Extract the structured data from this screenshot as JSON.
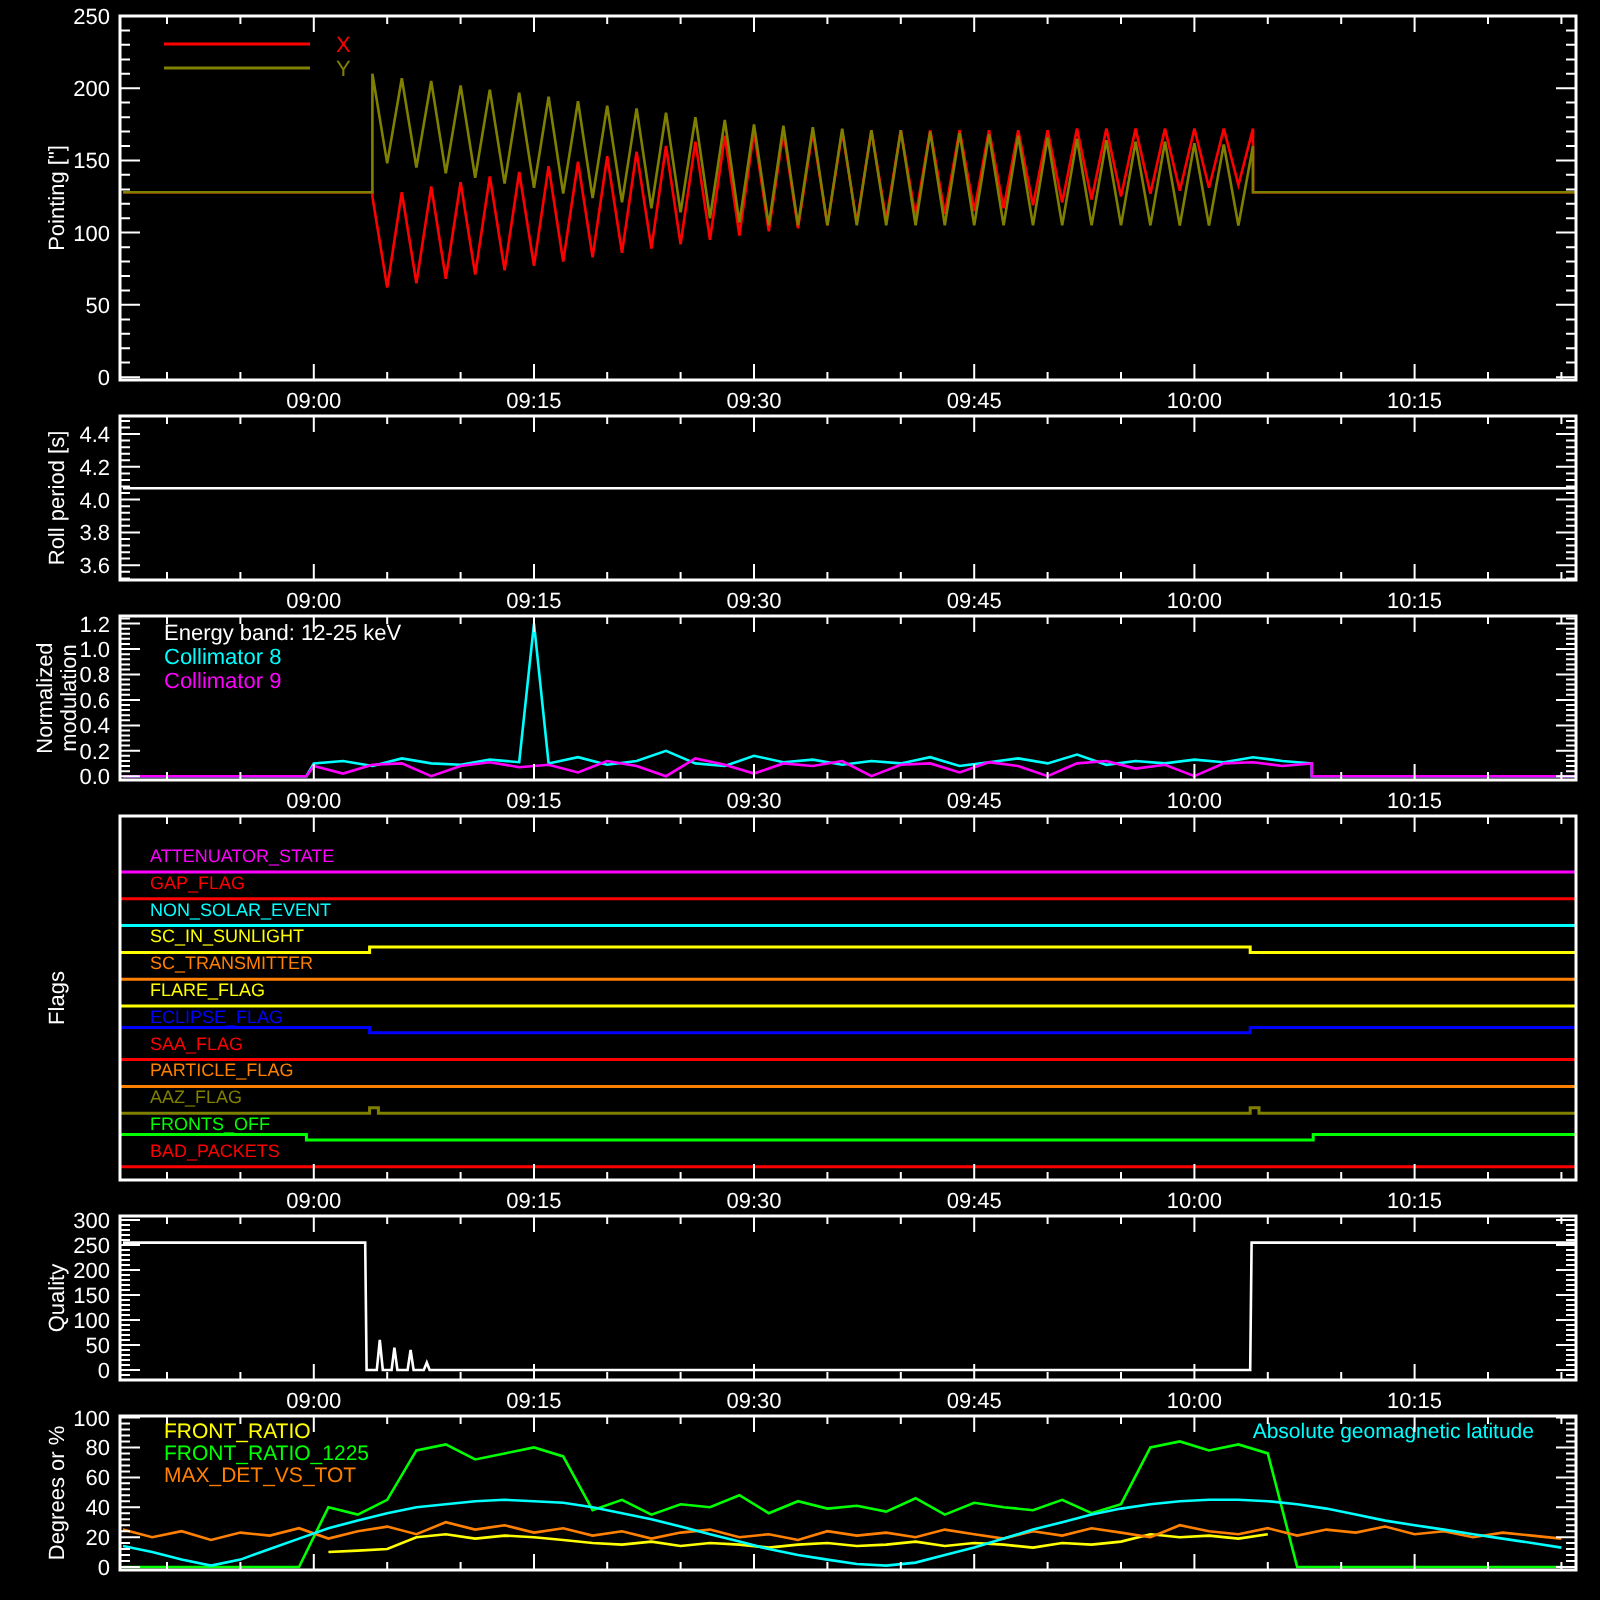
{
  "panels": [
    {
      "kind": "pointing",
      "chart_data": {
        "type": "line",
        "ylabel": "Pointing [\"]",
        "xlim": [
          526.8,
          626
        ],
        "ylim": [
          -2,
          250
        ],
        "xticks": [
          {
            "value": 540,
            "label": "09:00"
          },
          {
            "value": 555,
            "label": "09:15"
          },
          {
            "value": 570,
            "label": "09:30"
          },
          {
            "value": 585,
            "label": "09:45"
          },
          {
            "value": 600,
            "label": "10:00"
          },
          {
            "value": 615,
            "label": "10:15"
          }
        ],
        "yticks": [
          0,
          50,
          100,
          150,
          200,
          250
        ],
        "x": [
          527,
          544,
          544,
          545,
          546,
          547,
          548,
          549,
          550,
          551,
          552,
          553,
          554,
          555,
          556,
          557,
          558,
          559,
          560,
          561,
          562,
          563,
          564,
          565,
          566,
          567,
          568,
          569,
          570,
          571,
          572,
          573,
          574,
          575,
          576,
          577,
          578,
          579,
          580,
          581,
          582,
          583,
          584,
          585,
          586,
          587,
          588,
          589,
          590,
          591,
          592,
          593,
          594,
          595,
          596,
          597,
          598,
          599,
          600,
          601,
          602,
          603,
          604,
          604,
          626
        ],
        "series": [
          {
            "name": "X",
            "color": "#ff0000",
            "values": [
              128,
              128,
              125,
              62,
              128,
              65,
              132,
              68,
              135,
              71,
              139,
              74,
              142,
              77,
              146,
              80,
              149,
              83,
              153,
              86,
              156,
              89,
              160,
              92,
              163,
              95,
              167,
              98,
              170,
              101,
              170,
              103,
              170,
              105,
              170,
              107,
              171,
              109,
              171,
              111,
              171,
              113,
              171,
              115,
              171,
              117,
              171,
              119,
              171,
              121,
              172,
              123,
              172,
              125,
              172,
              127,
              172,
              129,
              172,
              131,
              172,
              133,
              172,
              128,
              128
            ]
          },
          {
            "name": "Y",
            "color": "#808000",
            "values": [
              128,
              128,
              210,
              148,
              207,
              145,
              205,
              141,
              202,
              138,
              199,
              134,
              197,
              131,
              194,
              127,
              191,
              124,
              188,
              121,
              186,
              117,
              183,
              114,
              180,
              110,
              178,
              107,
              175,
              105,
              174,
              105,
              173,
              105,
              172,
              105,
              171,
              105,
              171,
              105,
              170,
              105,
              169,
              105,
              168,
              105,
              167,
              105,
              166,
              105,
              165,
              105,
              164,
              105,
              163,
              105,
              163,
              105,
              162,
              105,
              161,
              105,
              160,
              128,
              128
            ]
          }
        ]
      }
    },
    {
      "kind": "roll",
      "chart_data": {
        "type": "line",
        "ylabel": "Roll period [s]",
        "xlim": [
          526.8,
          626
        ],
        "ylim": [
          3.51,
          4.51
        ],
        "xticks": [
          {
            "value": 540,
            "label": "09:00"
          },
          {
            "value": 555,
            "label": "09:15"
          },
          {
            "value": 570,
            "label": "09:30"
          },
          {
            "value": 585,
            "label": "09:45"
          },
          {
            "value": 600,
            "label": "10:00"
          },
          {
            "value": 615,
            "label": "10:15"
          }
        ],
        "yticks": [
          {
            "value": 3.6,
            "label": "3.6"
          },
          {
            "value": 3.8,
            "label": "3.8"
          },
          {
            "value": 4.0,
            "label": "4.0"
          },
          {
            "value": 4.2,
            "label": "4.2"
          },
          {
            "value": 4.4,
            "label": "4.4"
          }
        ],
        "x": [
          527,
          626
        ],
        "series": [
          {
            "color": "#ffffff",
            "values": [
              4.07,
              4.07
            ]
          }
        ]
      }
    },
    {
      "kind": "modulation",
      "chart_data": {
        "type": "line",
        "title": "Energy band: 12-25 keV",
        "ylabel": "Normalized\nmodulation",
        "xlim": [
          526.8,
          626
        ],
        "ylim": [
          -0.03,
          1.26
        ],
        "xticks": [
          {
            "value": 540,
            "label": "09:00"
          },
          {
            "value": 555,
            "label": "09:15"
          },
          {
            "value": 570,
            "label": "09:30"
          },
          {
            "value": 585,
            "label": "09:45"
          },
          {
            "value": 600,
            "label": "10:00"
          },
          {
            "value": 615,
            "label": "10:15"
          }
        ],
        "yticks": [
          {
            "value": 0,
            "label": "0.0"
          },
          {
            "value": 0.2,
            "label": "0.2"
          },
          {
            "value": 0.4,
            "label": "0.4"
          },
          {
            "value": 0.6,
            "label": "0.6"
          },
          {
            "value": 0.8,
            "label": "0.8"
          },
          {
            "value": 1.0,
            "label": "1.0"
          },
          {
            "value": 1.2,
            "label": "1.2"
          }
        ],
        "x": [
          527,
          539.5,
          540,
          542,
          544,
          546,
          548,
          550,
          552,
          554,
          555,
          556,
          558,
          560,
          562,
          564,
          566,
          568,
          570,
          572,
          574,
          576,
          578,
          580,
          582,
          584,
          586,
          588,
          590,
          592,
          594,
          596,
          598,
          600,
          602,
          604,
          606,
          608,
          608,
          626
        ],
        "series": [
          {
            "name": "Collimator 8",
            "color": "#00ffff",
            "values": [
              0,
              0,
              0.1,
              0.12,
              0.08,
              0.14,
              0.1,
              0.09,
              0.13,
              0.11,
              1.2,
              0.1,
              0.15,
              0.09,
              0.12,
              0.2,
              0.1,
              0.08,
              0.16,
              0.11,
              0.13,
              0.09,
              0.12,
              0.1,
              0.15,
              0.08,
              0.11,
              0.14,
              0.1,
              0.17,
              0.09,
              0.12,
              0.1,
              0.13,
              0.11,
              0.15,
              0.12,
              0.1,
              0,
              0
            ]
          },
          {
            "name": "Collimator 9",
            "color": "#ff00ff",
            "values": [
              0,
              0,
              0.08,
              0.02,
              0.09,
              0.1,
              0.0,
              0.08,
              0.11,
              0.07,
              0.08,
              0.09,
              0.03,
              0.12,
              0.08,
              0.0,
              0.14,
              0.09,
              0.02,
              0.1,
              0.08,
              0.12,
              0.0,
              0.09,
              0.1,
              0.03,
              0.11,
              0.08,
              0.0,
              0.1,
              0.12,
              0.06,
              0.09,
              0.0,
              0.1,
              0.11,
              0.08,
              0.1,
              0,
              0
            ]
          }
        ]
      }
    },
    {
      "kind": "flags",
      "ylabel": "Flags",
      "time_labels": [
        "09:00",
        "09:15",
        "09:30",
        "09:45",
        "10:00",
        "10:15"
      ],
      "flags": [
        {
          "label": "ATTENUATOR_STATE",
          "color": "#ff00ff",
          "kind": "flat"
        },
        {
          "label": "GAP_FLAG",
          "color": "#ff0000",
          "kind": "flat"
        },
        {
          "label": "NON_SOLAR_EVENT",
          "color": "#00ffff",
          "kind": "flat"
        },
        {
          "label": "SC_IN_SUNLIGHT",
          "color": "#ffff00",
          "kind": "raised_window"
        },
        {
          "label": "SC_TRANSMITTER",
          "color": "#ff8000",
          "kind": "flat"
        },
        {
          "label": "FLARE_FLAG",
          "color": "#ffff00",
          "kind": "flat"
        },
        {
          "label": "ECLIPSE_FLAG",
          "color": "#0000ff",
          "kind": "lowered_window"
        },
        {
          "label": "SAA_FLAG",
          "color": "#ff0000",
          "kind": "flat"
        },
        {
          "label": "PARTICLE_FLAG",
          "color": "#ff8000",
          "kind": "flat"
        },
        {
          "label": "AAZ_FLAG",
          "color": "#808000",
          "kind": "pulses"
        },
        {
          "label": "FRONTS_OFF",
          "color": "#00ff00",
          "kind": "raised_ends"
        },
        {
          "label": "BAD_PACKETS",
          "color": "#ff0000",
          "kind": "flat"
        }
      ]
    },
    {
      "kind": "quality",
      "chart_data": {
        "type": "line",
        "ylabel": "Quality",
        "xlim": [
          526.8,
          626
        ],
        "ylim": [
          -20,
          308
        ],
        "xticks": [
          {
            "value": 540,
            "label": "09:00"
          },
          {
            "value": 555,
            "label": "09:15"
          },
          {
            "value": 570,
            "label": "09:30"
          },
          {
            "value": 585,
            "label": "09:45"
          },
          {
            "value": 600,
            "label": "10:00"
          },
          {
            "value": 615,
            "label": "10:15"
          }
        ],
        "yticks": [
          0,
          50,
          100,
          150,
          200,
          250,
          300
        ],
        "x": [
          527,
          543.5,
          543.6,
          544.3,
          544.5,
          544.7,
          545.3,
          545.5,
          545.7,
          546.4,
          546.6,
          546.8,
          547.5,
          547.7,
          547.9,
          603.8,
          603.9,
          626
        ],
        "series": [
          {
            "color": "#ffffff",
            "values": [
              255,
              255,
              0,
              0,
              60,
              0,
              0,
              45,
              0,
              0,
              40,
              0,
              0,
              15,
              0,
              0,
              255,
              255
            ]
          }
        ]
      }
    },
    {
      "kind": "ratios",
      "chart_data": {
        "type": "line",
        "ylabel": "Degrees or %",
        "xlim": [
          526.8,
          626
        ],
        "ylim": [
          -2,
          101
        ],
        "yticks": [
          0,
          20,
          40,
          60,
          80,
          100
        ],
        "x": [
          527,
          529,
          531,
          533,
          535,
          537,
          539,
          541,
          543,
          545,
          547,
          549,
          551,
          553,
          555,
          557,
          559,
          561,
          563,
          565,
          567,
          569,
          571,
          573,
          575,
          577,
          579,
          581,
          583,
          585,
          587,
          589,
          591,
          593,
          595,
          597,
          599,
          601,
          603,
          605,
          607,
          609,
          611,
          613,
          615,
          617,
          619,
          621,
          623,
          625
        ],
        "series": [
          {
            "name": "FRONT_RATIO",
            "color": "#ffff00",
            "values": [
              null,
              null,
              null,
              null,
              null,
              null,
              null,
              10,
              11,
              12,
              20,
              22,
              19,
              21,
              20,
              18,
              16,
              15,
              17,
              14,
              16,
              15,
              13,
              15,
              16,
              14,
              15,
              17,
              14,
              16,
              15,
              13,
              16,
              15,
              17,
              22,
              20,
              21,
              19,
              22,
              null,
              null,
              null,
              null,
              null,
              null,
              null,
              null,
              null,
              null
            ]
          },
          {
            "name": "FRONT_RATIO_1225",
            "color": "#00ff00",
            "values": [
              0,
              0,
              0,
              0,
              0,
              0,
              0,
              40,
              35,
              45,
              78,
              82,
              72,
              76,
              80,
              74,
              38,
              45,
              35,
              42,
              40,
              48,
              36,
              44,
              39,
              41,
              37,
              46,
              35,
              43,
              40,
              38,
              45,
              36,
              42,
              80,
              84,
              78,
              82,
              76,
              0,
              0,
              0,
              0,
              0,
              0,
              0,
              0,
              0,
              0
            ]
          },
          {
            "name": "MAX_DET_VS_TOT",
            "color": "#ff8000",
            "values": [
              25,
              20,
              24,
              18,
              23,
              21,
              26,
              19,
              24,
              27,
              22,
              30,
              25,
              28,
              23,
              26,
              21,
              24,
              19,
              23,
              25,
              20,
              22,
              18,
              24,
              21,
              23,
              20,
              25,
              22,
              19,
              24,
              21,
              26,
              23,
              20,
              28,
              24,
              22,
              26,
              21,
              25,
              23,
              27,
              22,
              24,
              20,
              23,
              21,
              19
            ]
          },
          {
            "name": "Absolute geomagnetic latitude",
            "color": "#00ffff",
            "values": [
              14,
              10,
              5,
              1,
              5,
              12,
              19,
              26,
              31,
              36,
              40,
              42,
              44,
              45,
              44,
              43,
              40,
              36,
              32,
              27,
              22,
              17,
              12,
              8,
              5,
              2,
              1,
              3,
              8,
              13,
              19,
              25,
              30,
              35,
              39,
              42,
              44,
              45,
              45,
              44,
              42,
              39,
              35,
              31,
              28,
              25,
              22,
              19,
              16,
              13
            ]
          }
        ]
      }
    }
  ]
}
